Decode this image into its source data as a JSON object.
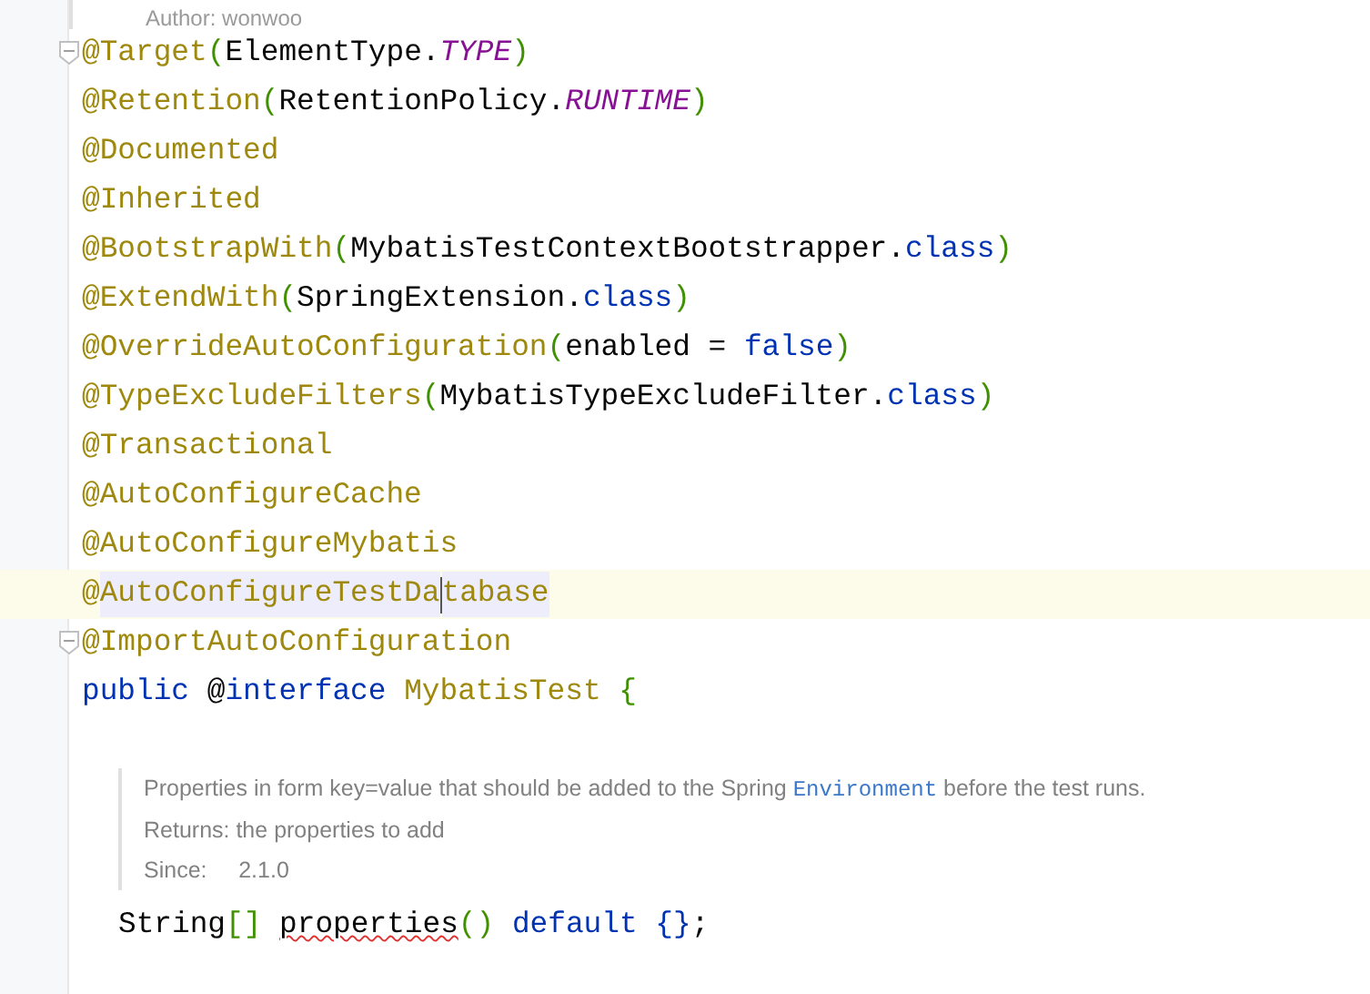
{
  "doc_top": {
    "text": "Author:  wonwoo"
  },
  "code_lines": [
    {
      "fold": true,
      "current": false,
      "tokens": [
        {
          "kind": "annotation",
          "text": "@Target"
        },
        {
          "kind": "paren",
          "text": "("
        },
        {
          "kind": "plain",
          "text": "ElementType."
        },
        {
          "kind": "constant",
          "text": "TYPE"
        },
        {
          "kind": "paren",
          "text": ")"
        }
      ]
    },
    {
      "fold": false,
      "current": false,
      "tokens": [
        {
          "kind": "annotation",
          "text": "@Retention"
        },
        {
          "kind": "paren",
          "text": "("
        },
        {
          "kind": "plain",
          "text": "RetentionPolicy."
        },
        {
          "kind": "constant",
          "text": "RUNTIME"
        },
        {
          "kind": "paren",
          "text": ")"
        }
      ]
    },
    {
      "fold": false,
      "current": false,
      "tokens": [
        {
          "kind": "annotation",
          "text": "@Documented"
        }
      ]
    },
    {
      "fold": false,
      "current": false,
      "tokens": [
        {
          "kind": "annotation",
          "text": "@Inherited"
        }
      ]
    },
    {
      "fold": false,
      "current": false,
      "tokens": [
        {
          "kind": "annotation",
          "text": "@BootstrapWith"
        },
        {
          "kind": "paren",
          "text": "("
        },
        {
          "kind": "plain",
          "text": "MybatisTestContextBootstrapper."
        },
        {
          "kind": "keyword",
          "text": "class"
        },
        {
          "kind": "paren",
          "text": ")"
        }
      ]
    },
    {
      "fold": false,
      "current": false,
      "tokens": [
        {
          "kind": "annotation",
          "text": "@ExtendWith"
        },
        {
          "kind": "paren",
          "text": "("
        },
        {
          "kind": "plain",
          "text": "SpringExtension."
        },
        {
          "kind": "keyword",
          "text": "class"
        },
        {
          "kind": "paren",
          "text": ")"
        }
      ]
    },
    {
      "fold": false,
      "current": false,
      "tokens": [
        {
          "kind": "annotation",
          "text": "@OverrideAutoConfiguration"
        },
        {
          "kind": "paren",
          "text": "("
        },
        {
          "kind": "plain",
          "text": "enabled = "
        },
        {
          "kind": "keyword",
          "text": "false"
        },
        {
          "kind": "paren",
          "text": ")"
        }
      ]
    },
    {
      "fold": false,
      "current": false,
      "tokens": [
        {
          "kind": "annotation",
          "text": "@TypeExcludeFilters"
        },
        {
          "kind": "paren",
          "text": "("
        },
        {
          "kind": "plain",
          "text": "MybatisTypeExcludeFilter."
        },
        {
          "kind": "keyword",
          "text": "class"
        },
        {
          "kind": "paren",
          "text": ")"
        }
      ]
    },
    {
      "fold": false,
      "current": false,
      "tokens": [
        {
          "kind": "annotation",
          "text": "@Transactional"
        }
      ]
    },
    {
      "fold": false,
      "current": false,
      "tokens": [
        {
          "kind": "annotation",
          "text": "@AutoConfigureCache"
        }
      ]
    },
    {
      "fold": false,
      "current": false,
      "tokens": [
        {
          "kind": "annotation",
          "text": "@AutoConfigureMybatis"
        }
      ]
    },
    {
      "fold": false,
      "current": true,
      "tokens": [
        {
          "kind": "annotation",
          "text": "@"
        },
        {
          "kind": "annotation",
          "text": "AutoConfigureTestDa",
          "highlighted": true
        },
        {
          "kind": "caret"
        },
        {
          "kind": "annotation",
          "text": "tabase",
          "highlighted": true
        }
      ]
    },
    {
      "fold": true,
      "current": false,
      "tokens": [
        {
          "kind": "annotation",
          "text": "@ImportAutoConfiguration"
        }
      ]
    },
    {
      "fold": false,
      "current": false,
      "tokens": [
        {
          "kind": "keyword",
          "text": "public "
        },
        {
          "kind": "plain",
          "text": "@"
        },
        {
          "kind": "keyword",
          "text": "interface "
        },
        {
          "kind": "annotation",
          "text": "MybatisTest "
        },
        {
          "kind": "paren",
          "text": "{"
        }
      ]
    }
  ],
  "javadoc": [
    {
      "segments": [
        {
          "kind": "text",
          "text": "Properties in form key=value that should be added to the Spring "
        },
        {
          "kind": "code",
          "text": "Environment"
        },
        {
          "kind": "text",
          "text": " before the test runs."
        }
      ]
    },
    {
      "segments": [
        {
          "kind": "text",
          "text": "Returns: the properties to add"
        }
      ]
    },
    {
      "segments": [
        {
          "kind": "text",
          "text": "Since:     2.1.0"
        }
      ]
    }
  ],
  "member_line": {
    "tokens": [
      {
        "kind": "plain",
        "text": "String"
      },
      {
        "kind": "paren",
        "text": "[] "
      },
      {
        "kind": "plain",
        "text": "properties",
        "typo": true
      },
      {
        "kind": "paren",
        "text": "() "
      },
      {
        "kind": "keyword",
        "text": "default {}"
      },
      {
        "kind": "plain",
        "text": ";"
      }
    ]
  }
}
